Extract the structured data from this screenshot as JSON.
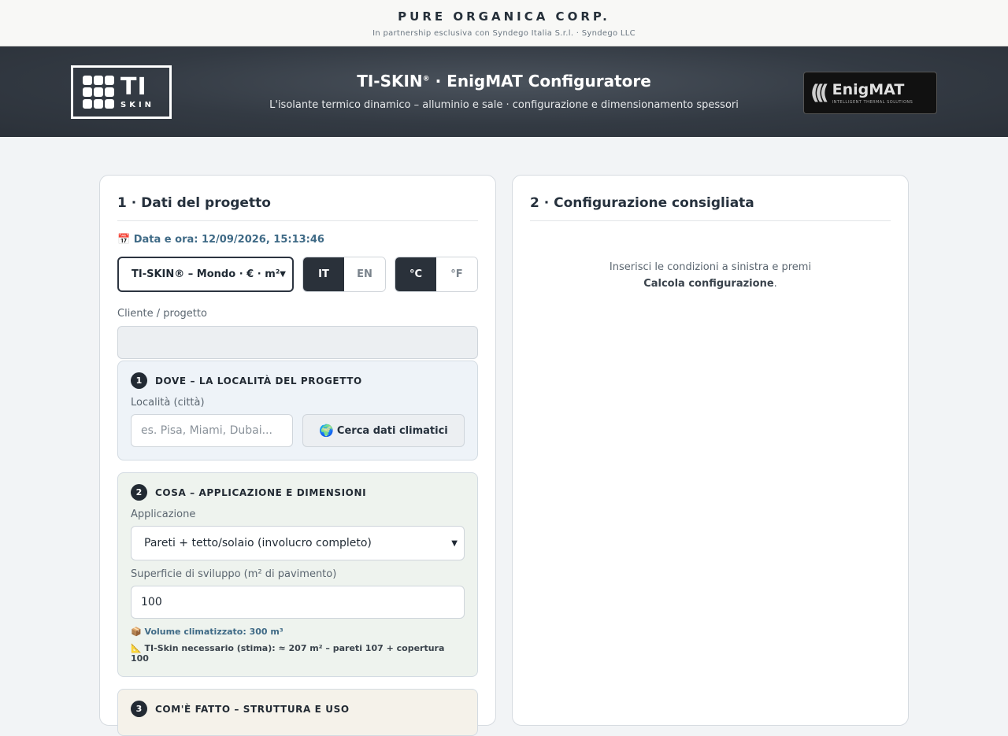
{
  "brand": {
    "corp": "PURE ORGANICA CORP.",
    "partner": "In partnership esclusiva con Syndego Italia S.r.l. · Syndego LLC"
  },
  "hero": {
    "title_main": "TI-SKIN",
    "title_sup": "®",
    "title_rest": " · EnigMAT Configuratore",
    "subtitle": "L'isolante termico dinamico – alluminio e sale · configurazione e dimensionamento spessori",
    "logo_left_big": "TI",
    "logo_left_small": "SKIN",
    "logo_right_name": "EnigMAT",
    "logo_right_tag": "INTELLIGENT THERMAL SOLUTIONS"
  },
  "left": {
    "heading": "1 · Dati del progetto",
    "datetime": "📅 Data e ora: 12/09/2026, 15:13:46",
    "preset": "TI-SKIN® – Mondo · € · m²",
    "lang": [
      "IT",
      "EN"
    ],
    "lang_active": "IT",
    "temp": [
      "°C",
      "°F"
    ],
    "temp_active": "°C",
    "client_label": "Cliente / progetto",
    "client_value": "",
    "step1": {
      "num": "1",
      "title": "DOVE – LA LOCALITÀ DEL PROGETTO",
      "city_label": "Località (città)",
      "city_placeholder": "es. Pisa, Miami, Dubai...",
      "button": "Cerca dati climatici",
      "button_icon": "🌍"
    },
    "step2": {
      "num": "2",
      "title": "COSA – APPLICAZIONE E DIMENSIONI",
      "app_label": "Applicazione",
      "app_value": "Pareti + tetto/solaio (involucro completo)",
      "area_label": "Superficie di sviluppo (m² di pavimento)",
      "area_value": "100",
      "volume": "📦 Volume climatizzato: 300 m³",
      "estimate": "📐 TI-Skin necessario (stima): ≈ 207 m² – pareti 107 + copertura 100"
    },
    "step3": {
      "num": "3",
      "title": "COM'È FATTO – STRUTTURA E USO"
    }
  },
  "right": {
    "heading": "2 · Configurazione consigliata",
    "placeholder_line1": "Inserisci le condizioni a sinistra e premi",
    "placeholder_bold": "Calcola configurazione",
    "placeholder_end": "."
  }
}
